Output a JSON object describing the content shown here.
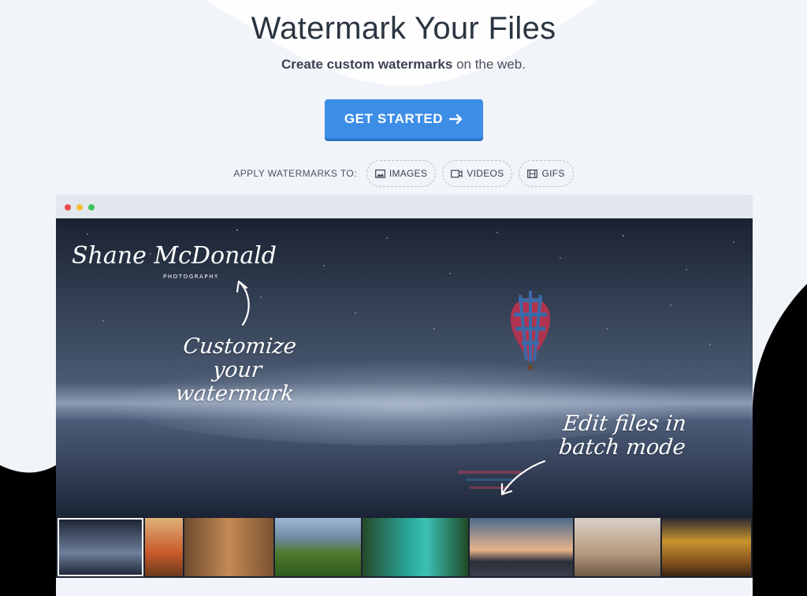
{
  "hero": {
    "title": "Watermark Your Files",
    "subtitle_bold": "Create custom watermarks",
    "subtitle_rest": " on the web."
  },
  "cta": {
    "label": "GET STARTED"
  },
  "apply": {
    "label": "APPLY WATERMARKS TO:",
    "options": [
      {
        "label": "IMAGES",
        "icon": "image-icon"
      },
      {
        "label": "VIDEOS",
        "icon": "video-icon"
      },
      {
        "label": "GIFS",
        "icon": "film-icon"
      }
    ]
  },
  "preview": {
    "caption_customize_line1": "Customize your",
    "caption_customize_line2": "watermark",
    "caption_batch_line1": "Edit files in",
    "caption_batch_line2": "batch mode",
    "watermark_signature": "Shane McDonald",
    "watermark_sub": "PHOTOGRAPHY"
  },
  "colors": {
    "page_top": "#f1f4f9",
    "page_bottom": "#000000",
    "accent": "#3c8de6",
    "title": "#2b3441"
  }
}
